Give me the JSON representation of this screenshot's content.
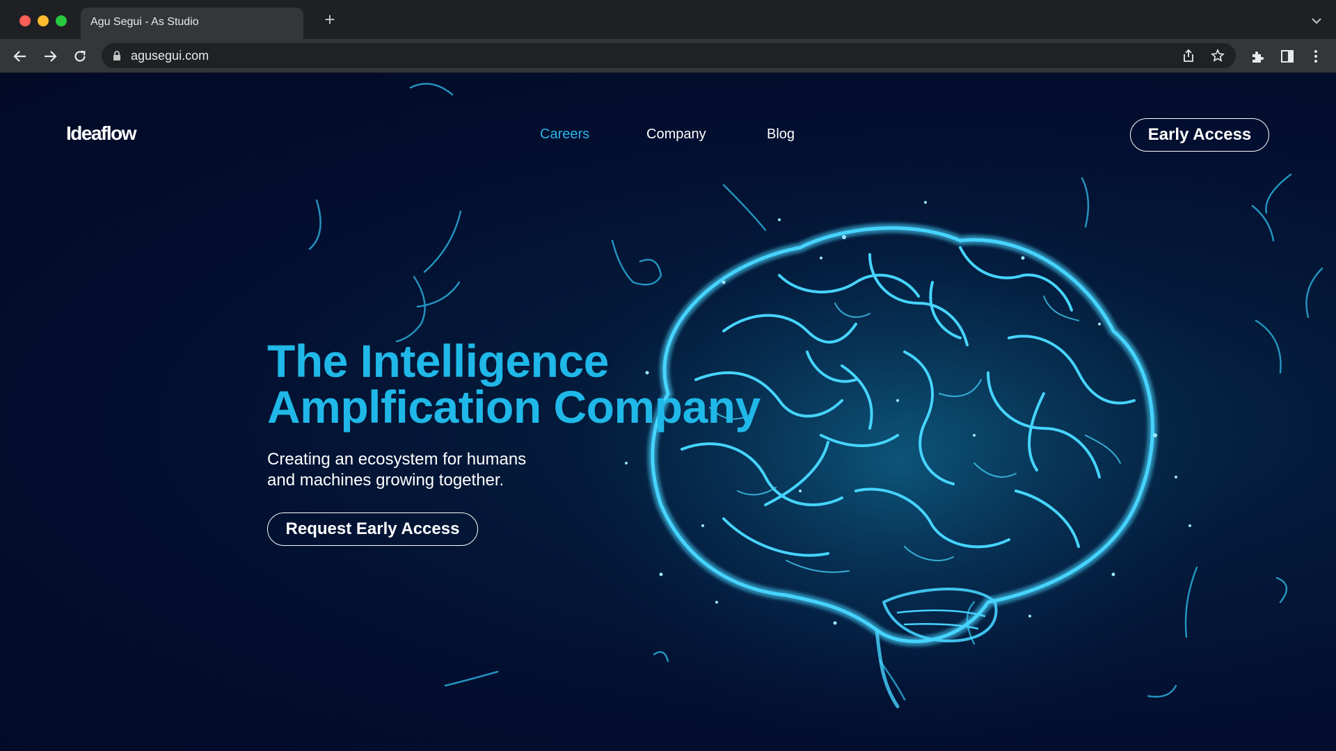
{
  "browser": {
    "tab_title": "Agu Segui - As Studio",
    "new_tab_symbol": "+",
    "url": "agusegui.com",
    "icons": [
      "back-arrow-icon",
      "forward-arrow-icon",
      "reload-icon",
      "lock-icon",
      "share-icon",
      "star-icon",
      "extensions-icon",
      "side-panel-icon",
      "more-menu-icon",
      "tab-search-icon"
    ]
  },
  "site": {
    "logo": "Ideaflow",
    "nav": [
      "Careers",
      "Company",
      "Blog"
    ],
    "active_nav": "Careers",
    "cta_top": "Early Access",
    "headline_line1": "The Intelligence",
    "headline_line2": "Amplfication Company",
    "subtitle_line1": "Creating an ecosystem for humans",
    "subtitle_line2": "and machines growing together.",
    "cta_main": "Request Early Access"
  },
  "colors": {
    "background": "#030c2b",
    "accent": "#1fb8e8",
    "brain_glow": "#3fd3ff",
    "chrome_dark": "#1f2023",
    "chrome_toolbar": "#35363a"
  }
}
